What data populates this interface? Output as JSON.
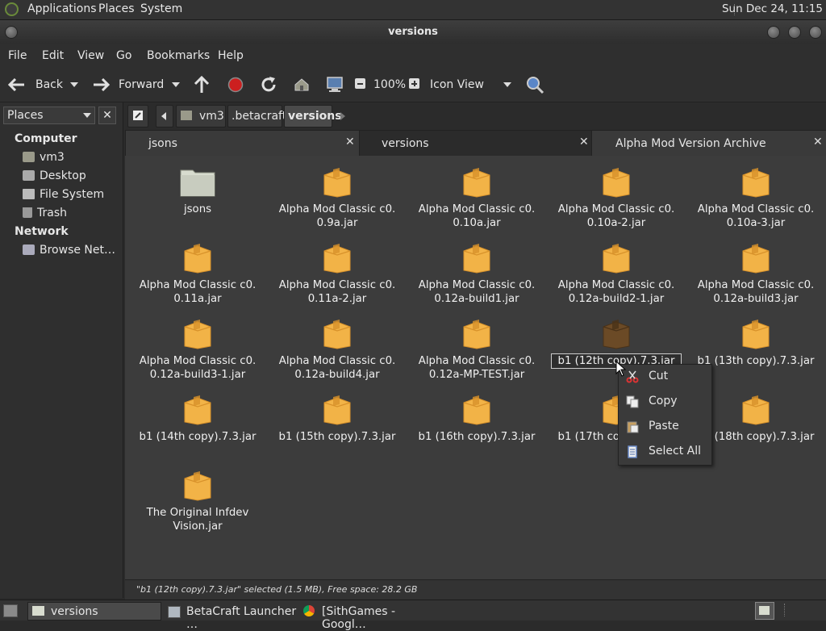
{
  "top_panel": {
    "menus": [
      "Applications",
      "Places",
      "System"
    ],
    "clock": "Sun Dec 24, 11:15"
  },
  "window": {
    "title": "versions"
  },
  "menubar": [
    "File",
    "Edit",
    "View",
    "Go",
    "Bookmarks",
    "Help"
  ],
  "toolbar": {
    "back": "Back",
    "forward": "Forward",
    "zoom": "100%",
    "view_mode": "Icon View"
  },
  "sidebar": {
    "selector": "Places",
    "computer_header": "Computer",
    "computer_items": [
      "vm3",
      "Desktop",
      "File System",
      "Trash"
    ],
    "network_header": "Network",
    "network_items": [
      "Browse Net…"
    ]
  },
  "pathbar": [
    "vm3",
    ".betacraft",
    "versions"
  ],
  "tabs": [
    "jsons",
    "versions",
    "Alpha Mod Version Archive"
  ],
  "files": [
    {
      "line1": "jsons",
      "line2": "",
      "kind": "folder"
    },
    {
      "line1": "Alpha Mod Classic c0.",
      "line2": "0.9a.jar",
      "kind": "jar"
    },
    {
      "line1": "Alpha Mod Classic c0.",
      "line2": "0.10a.jar",
      "kind": "jar"
    },
    {
      "line1": "Alpha Mod Classic c0.",
      "line2": "0.10a-2.jar",
      "kind": "jar"
    },
    {
      "line1": "Alpha Mod Classic c0.",
      "line2": "0.10a-3.jar",
      "kind": "jar"
    },
    {
      "line1": "Alpha Mod Classic c0.",
      "line2": "0.11a.jar",
      "kind": "jar"
    },
    {
      "line1": "Alpha Mod Classic c0.",
      "line2": "0.11a-2.jar",
      "kind": "jar"
    },
    {
      "line1": "Alpha Mod Classic c0.",
      "line2": "0.12a-build1.jar",
      "kind": "jar"
    },
    {
      "line1": "Alpha Mod Classic c0.",
      "line2": "0.12a-build2-1.jar",
      "kind": "jar"
    },
    {
      "line1": "Alpha Mod Classic c0.",
      "line2": "0.12a-build3.jar",
      "kind": "jar"
    },
    {
      "line1": "Alpha Mod Classic c0.",
      "line2": "0.12a-build3-1.jar",
      "kind": "jar"
    },
    {
      "line1": "Alpha Mod Classic c0.",
      "line2": "0.12a-build4.jar",
      "kind": "jar"
    },
    {
      "line1": "Alpha Mod Classic c0.",
      "line2": "0.12a-MP-TEST.jar",
      "kind": "jar"
    },
    {
      "line1": "b1 (12th copy).7.3.jar",
      "line2": "",
      "kind": "jar-selected"
    },
    {
      "line1": "b1 (13th copy).7.3.jar",
      "line2": "",
      "kind": "jar"
    },
    {
      "line1": "b1 (14th copy).7.3.jar",
      "line2": "",
      "kind": "jar"
    },
    {
      "line1": "b1 (15th copy).7.3.jar",
      "line2": "",
      "kind": "jar"
    },
    {
      "line1": "b1 (16th copy).7.3.jar",
      "line2": "",
      "kind": "jar"
    },
    {
      "line1": "b1 (17th copy).7.3.jar",
      "line2": "",
      "kind": "jar"
    },
    {
      "line1": "b1 (18th copy).7.3.jar",
      "line2": "",
      "kind": "jar"
    },
    {
      "line1": "The Original Infdev",
      "line2": "Vision.jar",
      "kind": "jar"
    }
  ],
  "context_menu": [
    "Cut",
    "Copy",
    "Paste",
    "Select All"
  ],
  "status": "\"b1 (12th copy).7.3.jar\" selected (1.5 MB), Free space: 28.2 GB",
  "taskbar": [
    "versions",
    "BetaCraft Launcher …",
    "[SithGames - Googl…"
  ],
  "colors": {
    "package": "#f2b347",
    "package_dark": "#d7912a",
    "selected_package": "#6b4a26",
    "folder": "#d8dccf",
    "accent_stop": "#cc1f1f"
  }
}
